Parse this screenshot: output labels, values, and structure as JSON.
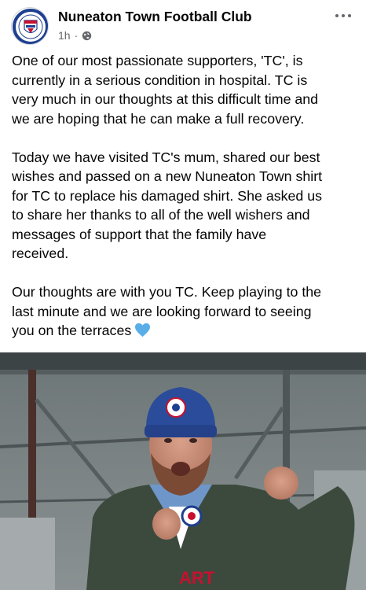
{
  "post": {
    "page_name": "Nuneaton Town Football Club",
    "timestamp": "1h",
    "separator": "·",
    "privacy_icon": "globe-icon",
    "menu_icon": "more-options-icon",
    "paragraphs": [
      {
        "lines": [
          "One of our most passionate supporters, 'TC', is",
          "currently in a serious condition in hospital. TC is",
          "very much in our thoughts at this difficult time and",
          "we are hoping that he can make a full recovery."
        ]
      },
      {
        "lines": [
          "Today we have visited TC's mum, shared our best",
          "wishes and passed on a new Nuneaton Town shirt",
          "for TC to replace his damaged shirt. She asked us",
          "to share her thanks to all of the well wishers and",
          "messages of support that the family have",
          "received."
        ]
      },
      {
        "lines": [
          "Our thoughts are with you TC. Keep playing to the",
          "last minute and we are looking forward to seeing",
          "you on the terraces"
        ],
        "emoji": "blue-heart-icon"
      }
    ]
  },
  "photo": {
    "shirt_text": "ART"
  },
  "colors": {
    "text": "#050505",
    "secondary_text": "#65676b",
    "heart": "#5aaee8",
    "hat": "#2b4c9a",
    "jacket": "#3c4a3e"
  }
}
